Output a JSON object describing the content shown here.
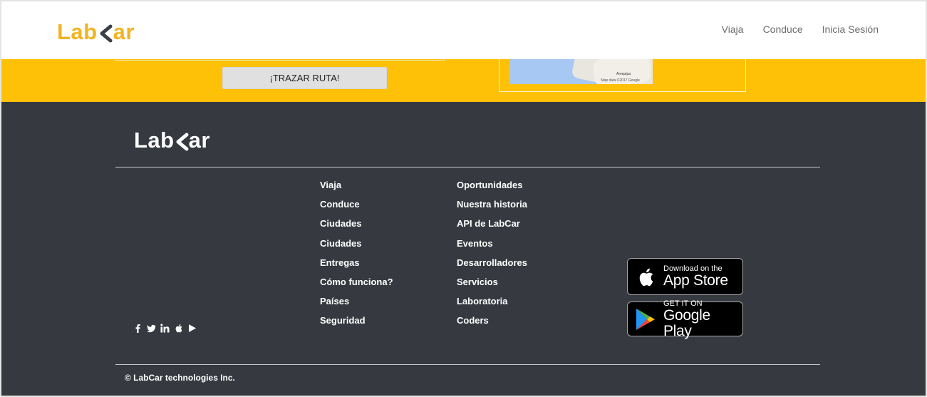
{
  "header": {
    "logo_prefix": "Lab",
    "logo_suffix": "ar",
    "nav": [
      "Viaja",
      "Conduce",
      "Inicia Sesión"
    ]
  },
  "hero": {
    "route_button": "¡TRAZAR RUTA!",
    "map_city": "Arequipa",
    "map_credit": "Map data ©2017 Google"
  },
  "footer": {
    "logo_prefix": "Lab",
    "logo_suffix": "ar",
    "col1": [
      "Viaja",
      "Conduce",
      "Ciudades",
      "Ciudades",
      "Entregas",
      "Cómo funciona?",
      "Países",
      "Seguridad"
    ],
    "col2": [
      "Oportunidades",
      "Nuestra historia",
      "API de LabCar",
      "Eventos",
      "Desarrolladores",
      "Servicios",
      "Laboratoria",
      "Coders"
    ],
    "social_icons": [
      "facebook-icon",
      "twitter-icon",
      "linkedin-icon",
      "apple-icon",
      "youtube-icon"
    ],
    "app_store": {
      "small": "Download on the",
      "big": "App Store"
    },
    "google_play": {
      "small": "GET IT ON",
      "big": "Google Play"
    },
    "copyright": "© LabCar technologies Inc."
  },
  "colors": {
    "accent": "#f3b422",
    "band": "#ffc107",
    "footer_bg": "#363a40"
  }
}
